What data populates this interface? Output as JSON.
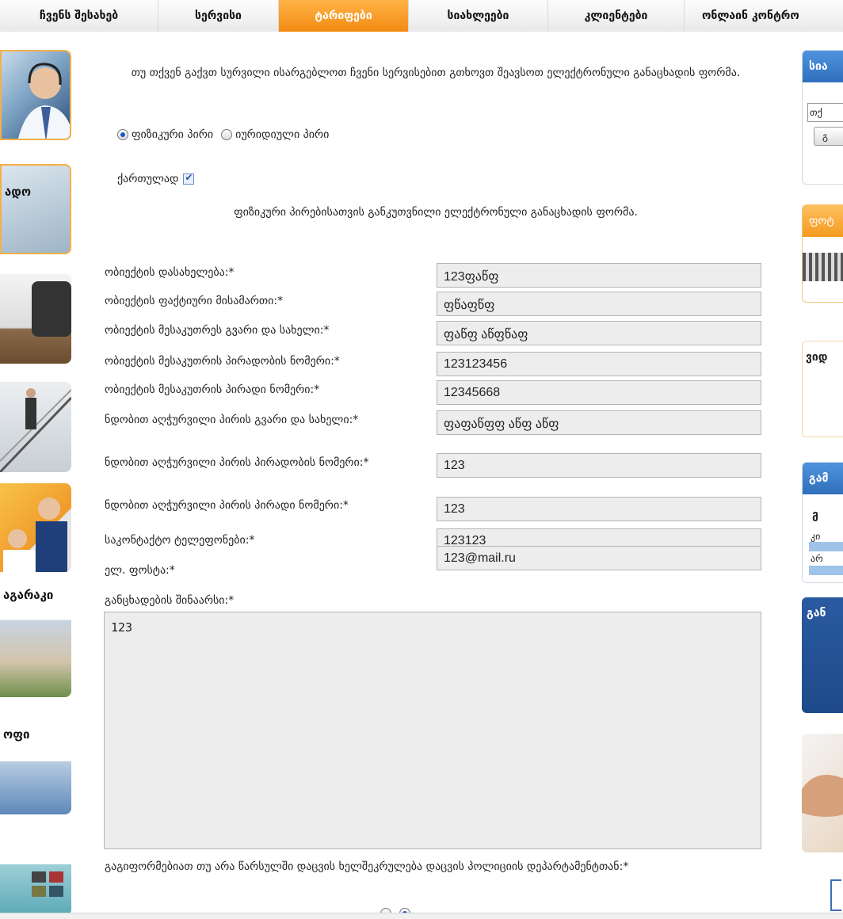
{
  "nav": {
    "tabs": [
      {
        "label": "ჩვენს შესახებ",
        "active": false
      },
      {
        "label": "სერვისი",
        "active": false
      },
      {
        "label": "ტარიფები",
        "active": true
      },
      {
        "label": "სიახლეები",
        "active": false
      },
      {
        "label": "კლიენტები",
        "active": false
      },
      {
        "label": "ონლაინ კონტრო",
        "active": false
      }
    ]
  },
  "left": {
    "thumbs": [
      {
        "label": ""
      },
      {
        "label": "ადო"
      },
      {
        "label": ""
      },
      {
        "label": ""
      },
      {
        "label": ""
      },
      {
        "label": "აგარაკი"
      },
      {
        "label": "ოფი"
      },
      {
        "label": ""
      }
    ]
  },
  "intro_text": "თუ თქვენ გაქვთ სურვილი ისარგებლოთ ჩვენი სერვისებით გთხოვთ შეავსოთ ელექტრონული განაცხადის ფორმა.",
  "person_type": {
    "options": [
      {
        "label": "ფიზიკური პირი",
        "selected": true
      },
      {
        "label": "იურიდიული პირი",
        "selected": false
      }
    ]
  },
  "georgian_toggle": {
    "label": "ქართულად",
    "checked": true
  },
  "form_title": "ფიზიკური პირებისათვის განკუთვნილი ელექტრონული განაცხადის ფორმა.",
  "fields": [
    {
      "label": "ობიექტის დასახელება:*",
      "value": "123ფაწფ"
    },
    {
      "label": "ობიექტის ფაქტიური მისამართი:*",
      "value": "ფწაფწფ"
    },
    {
      "label": "ობიექტის მესაკუთრეს გვარი და სახელი:*",
      "value": "ფაწფ აწფწაფ"
    },
    {
      "label": "ობიექტის მესაკუთრის პირადობის ნომერი:*",
      "value": "123123456"
    },
    {
      "label": "ობიექტის მესაკუთრის პირადი ნომერი:*",
      "value": "12345668"
    },
    {
      "label": "ნდობით აღჭურვილი პირის გვარი და სახელი:*",
      "value": "ფაფაწფფ აწფ აწფ"
    },
    {
      "label": "ნდობით აღჭურვილი პირის პირადობის ნომერი:*",
      "value": "123"
    },
    {
      "label": "ნდობით აღჭურვილი პირის პირადი ნომერი:*",
      "value": "123"
    },
    {
      "label": "საკონტაქტო ტელეფონები:*",
      "value": "123123"
    },
    {
      "label": "ელ. ფოსტა:*",
      "value": "123@mail.ru"
    }
  ],
  "statement": {
    "label": "განცხადების შინაარსი:*",
    "value": "123"
  },
  "contract_question": "გაგიფორმებიათ თუ არა წარსულში დაცვის ხელშეკრულება დაცვის პოლიციის დეპარტამენტთან:*",
  "right": {
    "search_title": "სია",
    "search_placeholder": "თქ",
    "search_button": "გ",
    "photo_title": "ფოტ",
    "video_title": "ვიდ",
    "calc_title": "გამ",
    "calc_sub": "მ",
    "calc_line1": "კი",
    "calc_line2": "არ",
    "news_title": "გან"
  },
  "colors": {
    "active_tab": "#f28a12",
    "box_blue": "#3d7cc9",
    "dark_blue": "#1e4a8a"
  }
}
